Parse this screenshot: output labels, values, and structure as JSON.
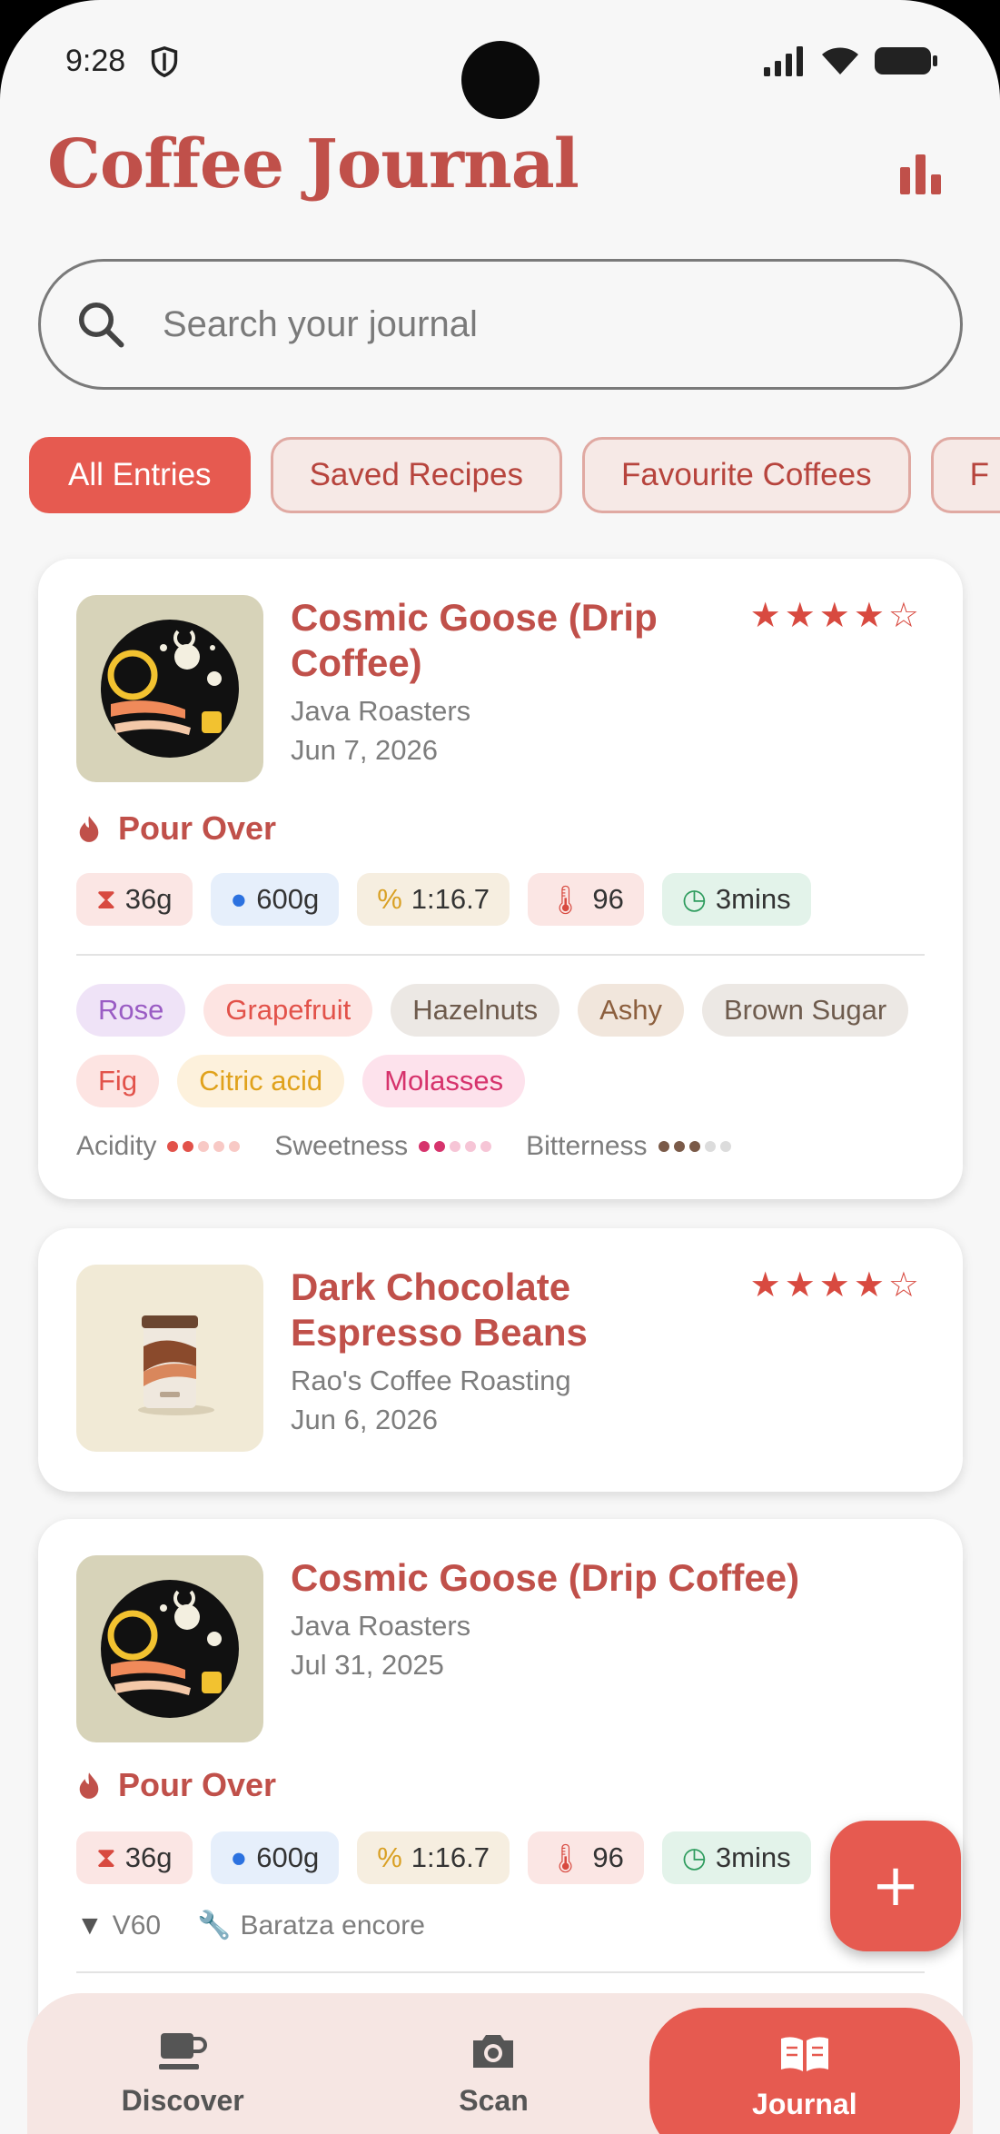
{
  "status_bar": {
    "time": "9:28"
  },
  "header": {
    "title": "Coffee Journal",
    "stats_icon": "bar-chart-icon"
  },
  "search": {
    "placeholder": "Search your journal"
  },
  "filters": [
    "All Entries",
    "Saved Recipes",
    "Favourite Coffees",
    "F"
  ],
  "entries": [
    {
      "title": "Cosmic Goose (Drip Coffee)",
      "roaster": "Java Roasters",
      "date": "Jun 7, 2026",
      "rating": 4,
      "stars": "★★★★☆",
      "method": "Pour Over",
      "params": {
        "dose": "36g",
        "water": "600g",
        "ratio": "1:16.7",
        "temp": "96",
        "time": "3mins"
      },
      "notes": [
        {
          "label": "Rose",
          "bg": "#efe3f7",
          "fg": "#9a5cc4"
        },
        {
          "label": "Grapefruit",
          "bg": "#fde4e2",
          "fg": "#e2524a"
        },
        {
          "label": "Hazelnuts",
          "bg": "#ece8e4",
          "fg": "#6e5b4d"
        },
        {
          "label": "Ashy",
          "bg": "#f1e6dc",
          "fg": "#8c5f3e"
        },
        {
          "label": "Brown Sugar",
          "bg": "#ece8e4",
          "fg": "#6e5b4d"
        },
        {
          "label": "Fig",
          "bg": "#fde4e2",
          "fg": "#e2524a"
        },
        {
          "label": "Citric acid",
          "bg": "#fdf1dc",
          "fg": "#e0a21c"
        },
        {
          "label": "Molasses",
          "bg": "#fde2ec",
          "fg": "#d6336c"
        }
      ],
      "scales": [
        {
          "label": "Acidity",
          "value": 2,
          "color": "#e2524a",
          "light": "#f8c9c5"
        },
        {
          "label": "Sweetness",
          "value": 2,
          "color": "#d6336c",
          "light": "#f6c5d6"
        },
        {
          "label": "Bitterness",
          "value": 3,
          "color": "#7a5a48",
          "light": "#dcdcdc"
        }
      ]
    },
    {
      "title": "Dark Chocolate Espresso Beans",
      "roaster": "Rao's Coffee Roasting",
      "date": "Jun 6, 2026",
      "rating": 4,
      "stars": "★★★★☆"
    },
    {
      "title": "Cosmic Goose (Drip Coffee)",
      "roaster": "Java Roasters",
      "date": "Jul 31, 2025",
      "method": "Pour Over",
      "params": {
        "dose": "36g",
        "water": "600g",
        "ratio": "1:16.7",
        "temp": "96",
        "time": "3mins"
      },
      "brewer": "V60",
      "grinder": "Baratza encore"
    }
  ],
  "fab": {
    "label": "+"
  },
  "nav": [
    {
      "label": "Discover",
      "icon": "coffee-cup-icon"
    },
    {
      "label": "Scan",
      "icon": "camera-icon"
    },
    {
      "label": "Journal",
      "icon": "open-book-icon"
    }
  ],
  "colors": {
    "accent": "#e65a50",
    "title": "#c0504a",
    "background": "#f7f7f7"
  }
}
